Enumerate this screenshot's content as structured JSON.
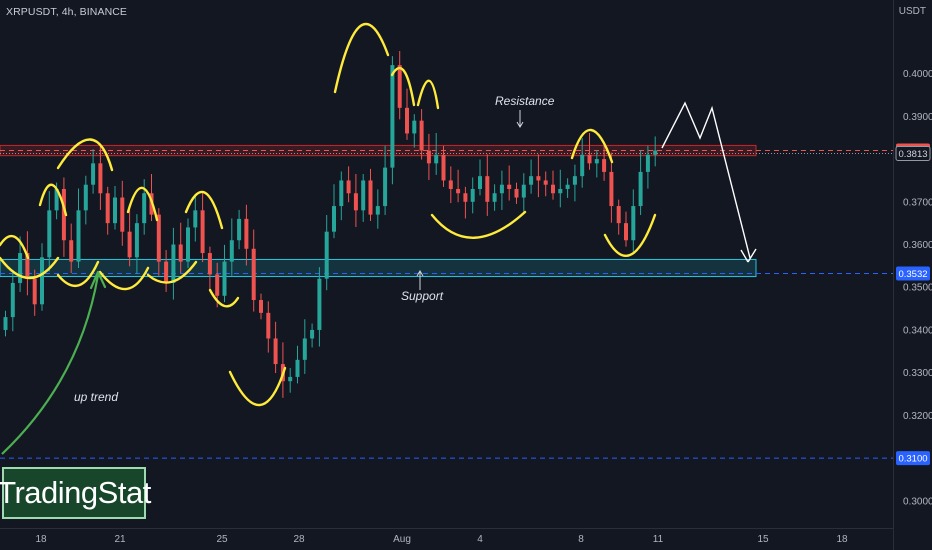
{
  "header": {
    "symbol_label": "XRPUSDT, 4h, BINANCE",
    "price_unit": "USDT"
  },
  "brand": {
    "logo_text": "TradingStat"
  },
  "colors": {
    "background": "#131722",
    "up_candle": "#26a69a",
    "down_candle": "#ef5350",
    "resistance_zone": "#c62828",
    "support_zone": "#26c6da",
    "support_line": "#2962ff",
    "highlight_yellow": "#ffeb3b",
    "uptrend_arrow": "#4caf50",
    "projection_white": "#ffffff"
  },
  "chart_data": {
    "type": "candlestick",
    "title": "",
    "ylim": [
      0.2955,
      0.4135
    ],
    "x_ticks": [
      "18",
      "21",
      "25",
      "28",
      "Aug",
      "4",
      "8",
      "11",
      "15",
      "18"
    ],
    "y_ticks": [
      "0.4000",
      "0.3900",
      "0.3700",
      "0.3600",
      "0.3500",
      "0.3400",
      "0.3300",
      "0.3200",
      "0.3000"
    ],
    "price_labels": [
      {
        "value": 0.382,
        "text": "0.3820",
        "kind": "resistance"
      },
      {
        "value": 0.3813,
        "text": "0.3813",
        "kind": "current"
      },
      {
        "value": 0.3532,
        "text": "0.3532",
        "kind": "support"
      },
      {
        "value": 0.31,
        "text": "0.3100",
        "kind": "support-line"
      }
    ],
    "zones": [
      {
        "name": "Resistance",
        "low": 0.3808,
        "high": 0.3832
      },
      {
        "name": "Support",
        "low": 0.3525,
        "high": 0.3565
      }
    ],
    "annotations": [
      "Resistance",
      "Support",
      "up trend"
    ],
    "closes": [
      0.343,
      0.351,
      0.358,
      0.352,
      0.346,
      0.357,
      0.368,
      0.373,
      0.361,
      0.356,
      0.368,
      0.374,
      0.379,
      0.372,
      0.365,
      0.371,
      0.363,
      0.357,
      0.365,
      0.372,
      0.367,
      0.356,
      0.351,
      0.36,
      0.356,
      0.364,
      0.368,
      0.358,
      0.353,
      0.348,
      0.356,
      0.361,
      0.366,
      0.359,
      0.347,
      0.344,
      0.338,
      0.332,
      0.328,
      0.329,
      0.333,
      0.338,
      0.34,
      0.352,
      0.363,
      0.369,
      0.375,
      0.372,
      0.368,
      0.375,
      0.367,
      0.369,
      0.378,
      0.402,
      0.392,
      0.386,
      0.389,
      0.382,
      0.379,
      0.381,
      0.375,
      0.373,
      0.372,
      0.37,
      0.373,
      0.376,
      0.37,
      0.372,
      0.374,
      0.373,
      0.371,
      0.374,
      0.376,
      0.375,
      0.374,
      0.372,
      0.373,
      0.374,
      0.376,
      0.381,
      0.379,
      0.38,
      0.377,
      0.369,
      0.365,
      0.361,
      0.369,
      0.377,
      0.381,
      0.382
    ]
  },
  "labels": {
    "resistance": "Resistance",
    "support": "Support",
    "uptrend": "up trend"
  }
}
